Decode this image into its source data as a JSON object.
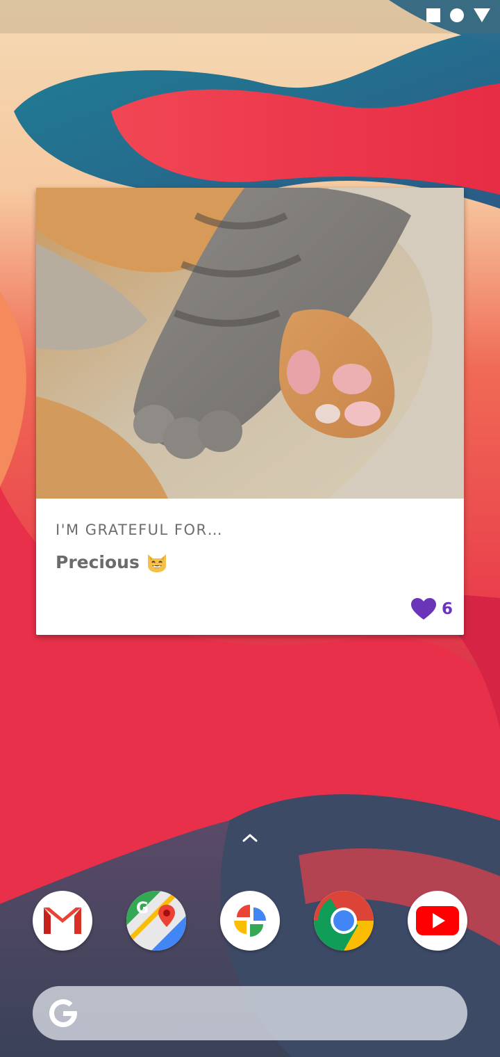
{
  "status_bar": {
    "icons": [
      "square-icon",
      "circle-icon",
      "triangle-icon"
    ]
  },
  "widget": {
    "photo_alt": "Two cat paws, a grey tabby paw and an orange paw with pink toe beans",
    "prompt": "I'M GRATEFUL FOR…",
    "entry_text": "Precious",
    "entry_emoji": "grinning-cat-emoji",
    "like_icon": "heart-icon",
    "like_count": "6",
    "accent_color": "#6a35b8"
  },
  "home": {
    "drawer_handle_icon": "chevron-up-icon"
  },
  "dock": {
    "apps": [
      {
        "name": "Gmail",
        "icon": "gmail-icon"
      },
      {
        "name": "Maps",
        "icon": "maps-icon"
      },
      {
        "name": "Photos",
        "icon": "photos-icon"
      },
      {
        "name": "Chrome",
        "icon": "chrome-icon"
      },
      {
        "name": "YouTube",
        "icon": "youtube-icon"
      }
    ]
  },
  "search_bar": {
    "icon": "google-g-icon"
  }
}
